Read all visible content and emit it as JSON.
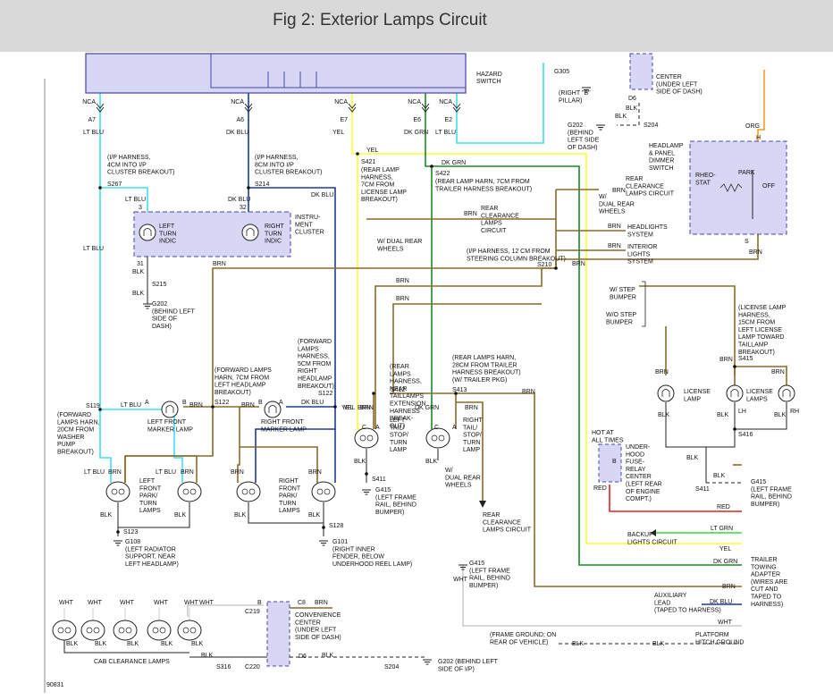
{
  "header": {
    "title": "Fig 2: Exterior Lamps Circuit"
  },
  "colors": {
    "lt_blu": "#3fe0ee",
    "dk_blu": "#1f3a9a",
    "yel": "#ffff33",
    "dk_grn": "#1a8a2a",
    "brn": "#8b6a2a",
    "red": "#e02020",
    "lt_grn": "#33dd33",
    "orange": "#ff9922",
    "wht": "#cccccc",
    "box": "#d7d7f5"
  },
  "labels": {
    "hazard": "HAZARD",
    "switch": "SWITCH",
    "nca": "NCA",
    "a7": "A7",
    "a6": "A6",
    "e7": "E7",
    "e6": "E6",
    "e2": "E2",
    "lt_blu": "LT BLU",
    "dk_blu": "DK BLU",
    "yel": "YEL",
    "dk_grn": "DK GRN",
    "brn": "BRN",
    "blk": "BLK",
    "orn": "ORG",
    "wht": "WHT",
    "red": "RED",
    "lt_grn": "LT GRN",
    "g305": "G305",
    "g305_desc": [
      "(RIGHT \"B\"",
      "PILLAR)"
    ],
    "center_top": [
      "CENTER",
      "(UNDER LEFT",
      "SIDE OF DASH)"
    ],
    "d6": "D6",
    "s204": "S204",
    "g202_top": [
      "G202",
      "(BEHIND",
      "LEFT SIDE",
      "OF DASH)"
    ],
    "headlamp_switch": [
      "HEADLAMP",
      "& PANEL",
      "DIMMER",
      "SWITCH"
    ],
    "rheostat": [
      "RHEO-",
      "STAT"
    ],
    "park": "PARK",
    "off": "OFF",
    "h": "H",
    "s": "S",
    "ip_harness_4cm": [
      "(I/P HARNESS,",
      "4CM INTO I/P",
      "CLUSTER BREAKOUT)"
    ],
    "s267": "S267",
    "ip_harness_8cm": [
      "(I/P HARNESS,",
      "8CM INTO I/P",
      "CLUSTER BREAKOUT)"
    ],
    "s214": "S214",
    "s421": "S421",
    "rear_lamp_7cm": [
      "(REAR LAMP",
      "HARNESS,",
      "7CM FROM",
      "LICENSE LAMP",
      "BREAKOUT)"
    ],
    "s422": "S422",
    "rear_lamp_7cm_trailer": [
      "(REAR LAMP HARN, 7CM FROM",
      "TRAILER HARNESS BREAKOUT)"
    ],
    "rear_clearance_lamps_circuit": [
      "REAR",
      "CLEARANCE",
      "LAMPS CIRCUIT"
    ],
    "w_dual_rear_wheels": [
      "W/",
      "DUAL REAR",
      "WHEELS"
    ],
    "rear_clearance_lamps_circuit2": [
      "REAR",
      "CLEARANCE",
      "LAMPS",
      "CIRCUIT"
    ],
    "headlights_system": [
      "HEADLIGHTS",
      "SYSTEM"
    ],
    "interior_lights_system": [
      "INTERIOR",
      "LIGHTS",
      "SYSTEM"
    ],
    "ip_harness_12cm": [
      "(I/P HARNESS, 12 CM FROM",
      "STEERING COLUMN BREAKOUT)"
    ],
    "s210": "S210",
    "w_dual_rear_wheels2": [
      "W/ DUAL REAR",
      "WHEELS"
    ],
    "left_turn_indic": [
      "LEFT",
      "TURN",
      "INDIC"
    ],
    "right_turn_indic": [
      "RIGHT",
      "TURN",
      "INDIC"
    ],
    "instrument_cluster": [
      "INSTRU-",
      "MENT",
      "CLUSTER"
    ],
    "pin3": "3",
    "pin32": "32",
    "pin31": "31",
    "s215": "S215",
    "g202_left": [
      "G202",
      "(BEHIND LEFT",
      "SIDE OF",
      "DASH)"
    ],
    "w_step_bumper": [
      "W/ STEP",
      "BUMPER"
    ],
    "wo_step_bumper": [
      "W/O STEP",
      "BUMPER"
    ],
    "license_lamp_harness": [
      "(LICENSE LAMP",
      "HARNESS,",
      "15CM FROM",
      "LEFT LICENSE",
      "LAMP TOWARD",
      "TAILLAMP",
      "BREAKOUT)"
    ],
    "s415": "S415",
    "license_lamp": [
      "LICENSE",
      "LAMP"
    ],
    "license_lamps": [
      "LICENSE",
      "LAMPS"
    ],
    "lh": "LH",
    "rh": "RH",
    "s416": "S416",
    "rear_lamps_harness_ext": [
      "(REAR",
      "LAMPS",
      "HARNESS,",
      "NEAR",
      "TAILLAMPS",
      "EXTENSION",
      "HARNESS",
      "BREAK-",
      "OUT)"
    ],
    "s412": "S412",
    "rear_lamps_harn_28cm": [
      "(REAR LAMPS HARN,",
      "28CM FROM TRAILER",
      "HARNESS BREAKOUT)",
      "(W/ TRAILER PKG)"
    ],
    "s413": "S413",
    "forward_lamps_5cm": [
      "(FORWARD",
      "LAMPS",
      "HARNESS,",
      "5CM FROM",
      "RIGHT",
      "HEADLAMP",
      "BREAKOUT)"
    ],
    "s122": "S122",
    "forward_lamps_7cm": [
      "(FORWARD LAMPS",
      "HARN, 7CM FROM",
      "LEFT HEADLAMP",
      "BREAKOUT)"
    ],
    "s119": "S119",
    "forward_lamps_20cm": [
      "(FORWARD",
      "LAMPS HARN,",
      "20CM FROM",
      "WASHER",
      "PUMP",
      "BREAKOUT)"
    ],
    "left_front_marker": [
      "LEFT FRONT",
      "MARKER LAMP"
    ],
    "right_front_marker": [
      "RIGHT FRONT",
      "MARKER LAMP"
    ],
    "left_front_park": [
      "LEFT",
      "FRONT",
      "PARK/",
      "TURN",
      "LAMPS"
    ],
    "right_front_park": [
      "RIGHT",
      "FRONT",
      "PARK/",
      "TURN",
      "LAMPS"
    ],
    "left_tail": [
      "LEFT",
      "TAIL/",
      "STOP/",
      "TURN",
      "LAMP"
    ],
    "right_tail": [
      "RIGHT",
      "TAIL/",
      "STOP/",
      "TURN",
      "LAMP"
    ],
    "hot_at_all_times": [
      "HOT AT",
      "ALL TIMES"
    ],
    "underhood_fuse": [
      "UNDER-",
      "HOOD",
      "FUSE-",
      "RELAY",
      "CENTER",
      "(LEFT REAR",
      "OF ENGINE",
      "COMPT.)"
    ],
    "s411": "S411",
    "g415_left": [
      "G415",
      "(LEFT FRAME",
      "RAIL, BEHIND",
      "BUMPER)"
    ],
    "g415_right": [
      "G415",
      "(LEFT FRAME",
      "RAIL, BEHIND",
      "BUMPER)"
    ],
    "g415_mid": [
      "G415",
      "(LEFT FRAME",
      "RAIL, BEHIND",
      "BUMPER)"
    ],
    "rear_clearance_lamps_circuit3": [
      "REAR",
      "CLEARANCE",
      "LAMPS CIRCUIT"
    ],
    "w_dual_rear_wheels3": [
      "W/",
      "DUAL REAR",
      "WHEELS"
    ],
    "s123": "S123",
    "g108": [
      "G108",
      "(LEFT RADIATOR",
      "SUPPORT, NEAR",
      "LEFT HEADLAMP)"
    ],
    "s128": "S128",
    "g101": [
      "G101",
      "(RIGHT INNER",
      "FENDER, BELOW",
      "UNDERHOOD REEL LAMP)"
    ],
    "backup_lights": [
      "BACKUP",
      "LIGHTS CIRCUIT"
    ],
    "trailer_adapter": [
      "TRAILER",
      "TOWING",
      "ADAPTER",
      "(WIRES ARE",
      "CUT AND",
      "TAPED TO",
      "HARNESS)"
    ],
    "auxiliary_lead": [
      "AUXILIARY",
      "LEAD",
      "(TAPED TO HARNESS)"
    ],
    "platform_hitch": [
      "PLATFORM",
      "HITCH GROUND"
    ],
    "frame_ground": [
      "(FRAME GROUND; ON",
      "REAR OF VEHICLE)"
    ],
    "convenience_center": [
      "CONVENIENCE",
      "CENTER",
      "(UNDER LEFT",
      "SIDE OF DASH)"
    ],
    "b": "B",
    "c8": "C8",
    "c219": "C219",
    "c220": "C220",
    "s316": "S316",
    "g202_bottom": [
      "G202 (BEHIND LEFT",
      "SIDE OF I/P)"
    ],
    "cab_clearance": "CAB CLEARANCE LAMPS",
    "fig_number": "90831",
    "pin_a": "A",
    "pin_b": "B",
    "pin_c": "C",
    "pin_g": "G"
  }
}
